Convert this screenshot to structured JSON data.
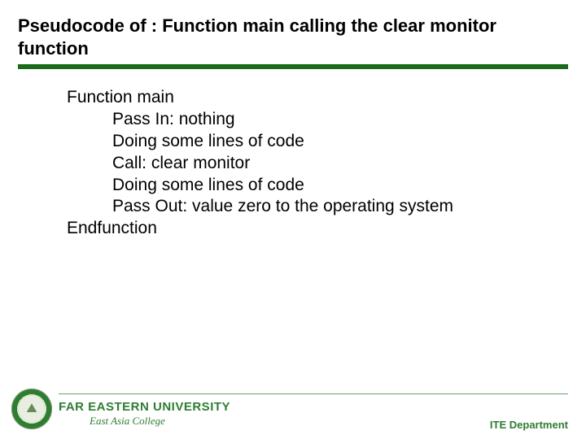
{
  "title": "Pseudocode of : Function main calling the clear monitor function",
  "body": {
    "line1": "Function main",
    "line2": "Pass In: nothing",
    "line3": "Doing some lines of code",
    "line4": "Call: clear monitor",
    "line5": "Doing some lines of code",
    "line6": "Pass Out: value zero to the operating system",
    "line7": "Endfunction"
  },
  "footer": {
    "university_main": "FAR EASTERN UNIVERSITY",
    "university_sub": "East Asia College",
    "department": "ITE Department"
  }
}
